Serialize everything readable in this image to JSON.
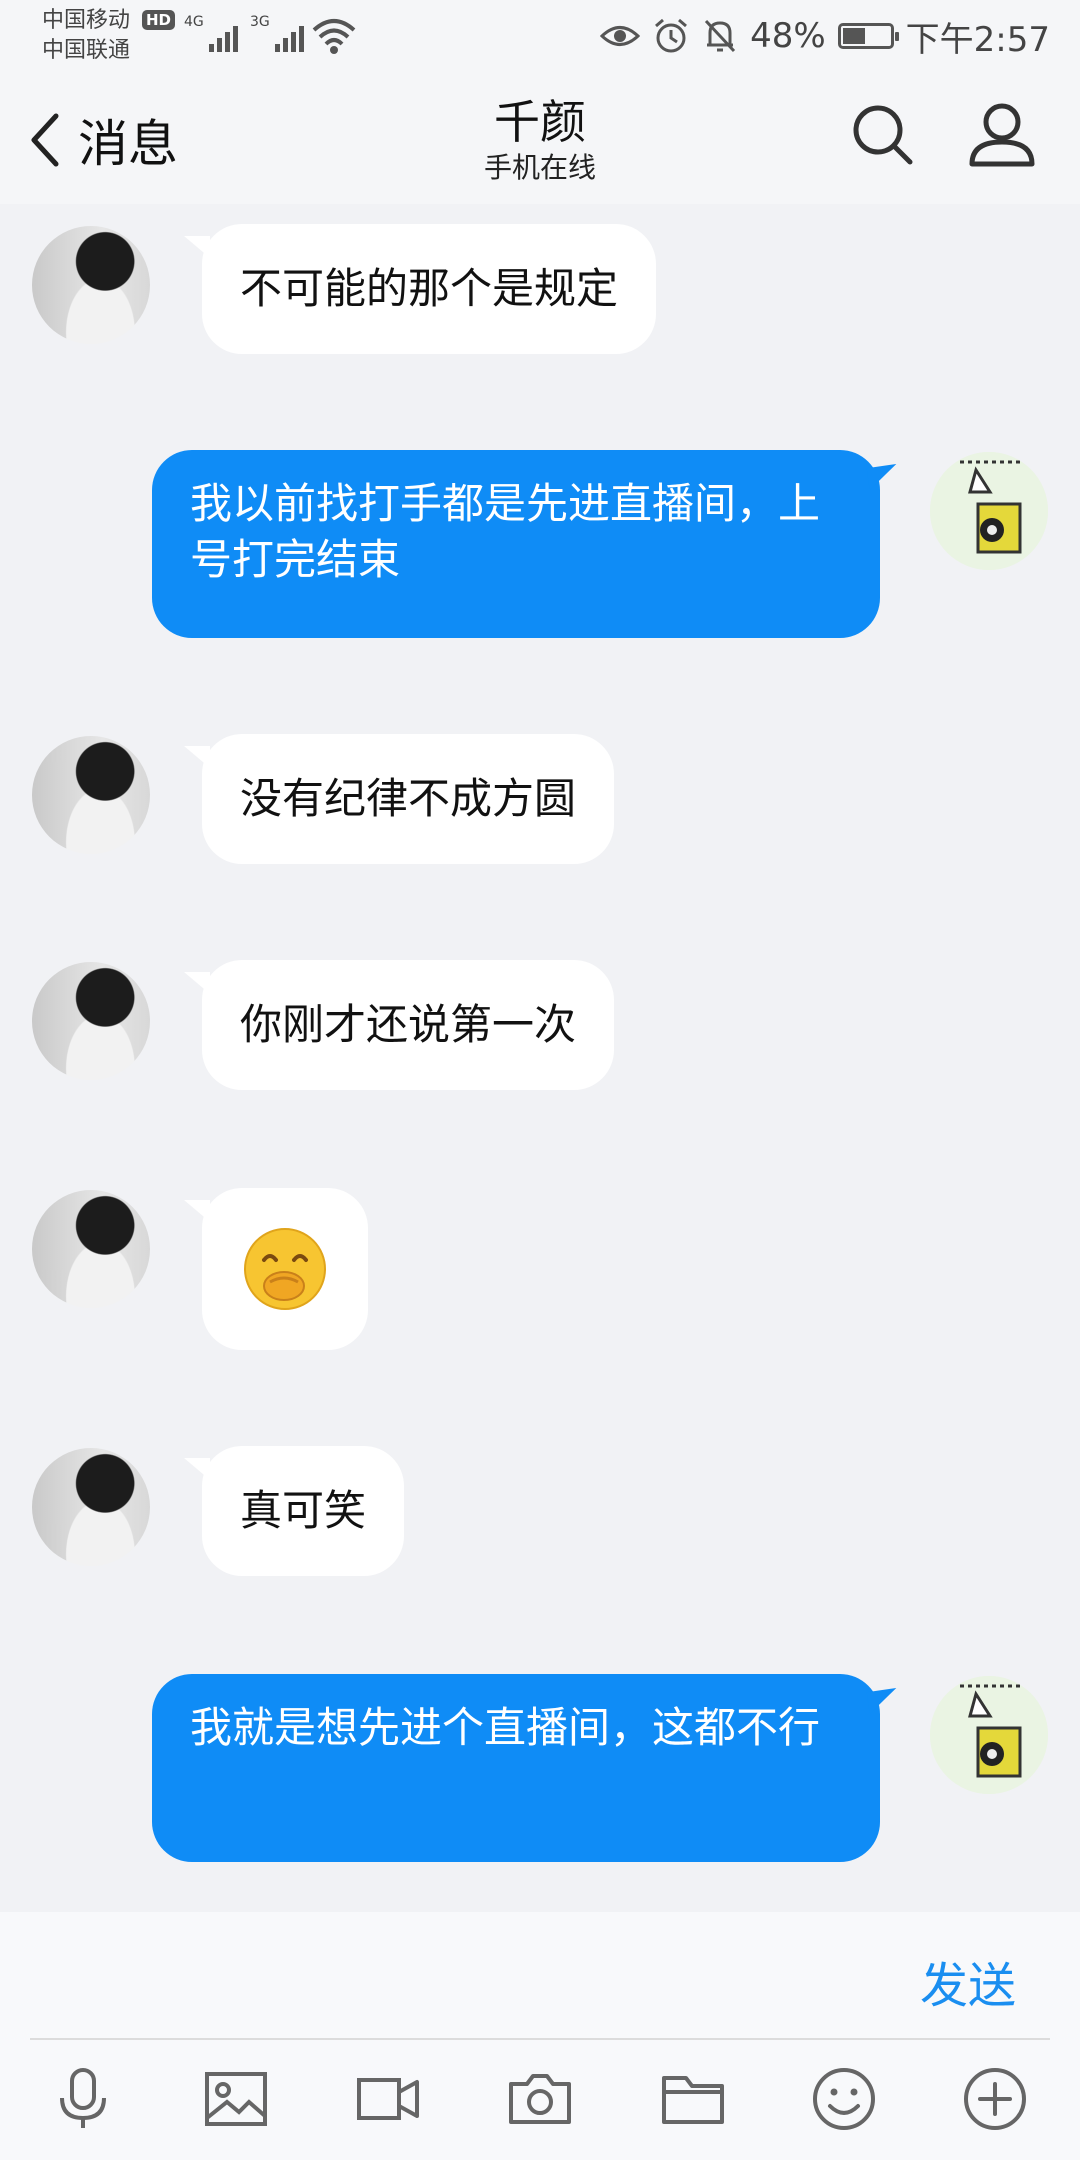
{
  "status": {
    "carrier1": "中国移动",
    "carrier2": "中国联通",
    "hd": "HD",
    "net1": "4G",
    "net2": "3G",
    "battery": "48%",
    "battery_level": 0.48,
    "time": "下午2:57"
  },
  "header": {
    "back_label": "消息",
    "title": "千颜",
    "subtitle": "手机在线"
  },
  "messages": [
    {
      "side": "left",
      "text": "不可能的那个是规定"
    },
    {
      "side": "right",
      "text": "我以前找打手都是先进直播间，上号打完结束"
    },
    {
      "side": "left",
      "text": "没有纪律不成方圆"
    },
    {
      "side": "left",
      "text": "你刚才还说第一次"
    },
    {
      "side": "left",
      "emoji": "🤭",
      "icon": "giggle-emoji"
    },
    {
      "side": "left",
      "text": "真可笑"
    },
    {
      "side": "right",
      "text": "我就是想先进个直播间，这都不行"
    }
  ],
  "input": {
    "send_label": "发送"
  },
  "toolbar": [
    "microphone-icon",
    "image-icon",
    "video-icon",
    "camera-icon",
    "folder-icon",
    "smiley-icon",
    "plus-icon"
  ],
  "colors": {
    "accent": "#0f8cf6",
    "send": "#1a8ef0",
    "background": "#f1f2f5"
  }
}
